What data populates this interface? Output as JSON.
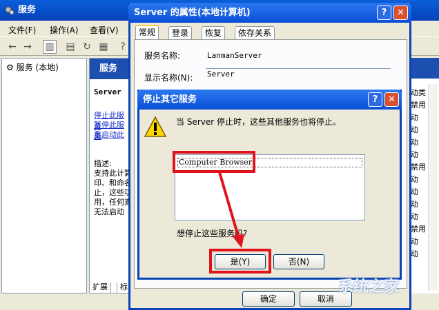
{
  "services_window": {
    "title": "服务",
    "menu": [
      "文件(F)",
      "操作(A)",
      "查看(V)"
    ],
    "tree_item": "服务 (本地)",
    "detail_header": "服务",
    "detail_name": "Server",
    "links": [
      "停止此服务",
      "暂停此服务",
      "重启动此"
    ],
    "desc_label": "描述:",
    "desc_lines": [
      "支持此计算",
      "印、和命名",
      "止，这些功",
      "用，任何直",
      "无法启动"
    ],
    "bottom_tabs": [
      "扩展",
      "标"
    ],
    "right_column": [
      "动类",
      "禁用",
      "动",
      "动",
      "动",
      "动",
      "禁用",
      "动",
      "动",
      "动",
      "动",
      "禁用",
      "动",
      "动"
    ]
  },
  "properties_dialog": {
    "title": "Server 的属性(本地计算机)",
    "tabs": [
      "常规",
      "登录",
      "恢复",
      "依存关系"
    ],
    "service_name_label": "服务名称:",
    "service_name_value": "LanmanServer",
    "display_name_label": "显示名称(N):",
    "display_name_value": "Server",
    "ok_button": "确定",
    "cancel_button": "取消"
  },
  "stop_dialog": {
    "title": "停止其它服务",
    "message": "当 Server 停止时，这些其他服务也将停止。",
    "services": [
      "Computer Browser"
    ],
    "question": "想停止这些服务吗?",
    "yes_button": "是(Y)",
    "no_button": "否(N)"
  },
  "watermark": "系统之家",
  "colors": {
    "titlebar": "#0a4fd4",
    "highlight_red": "#e0121c",
    "link_blue": "#1a2fcc"
  }
}
